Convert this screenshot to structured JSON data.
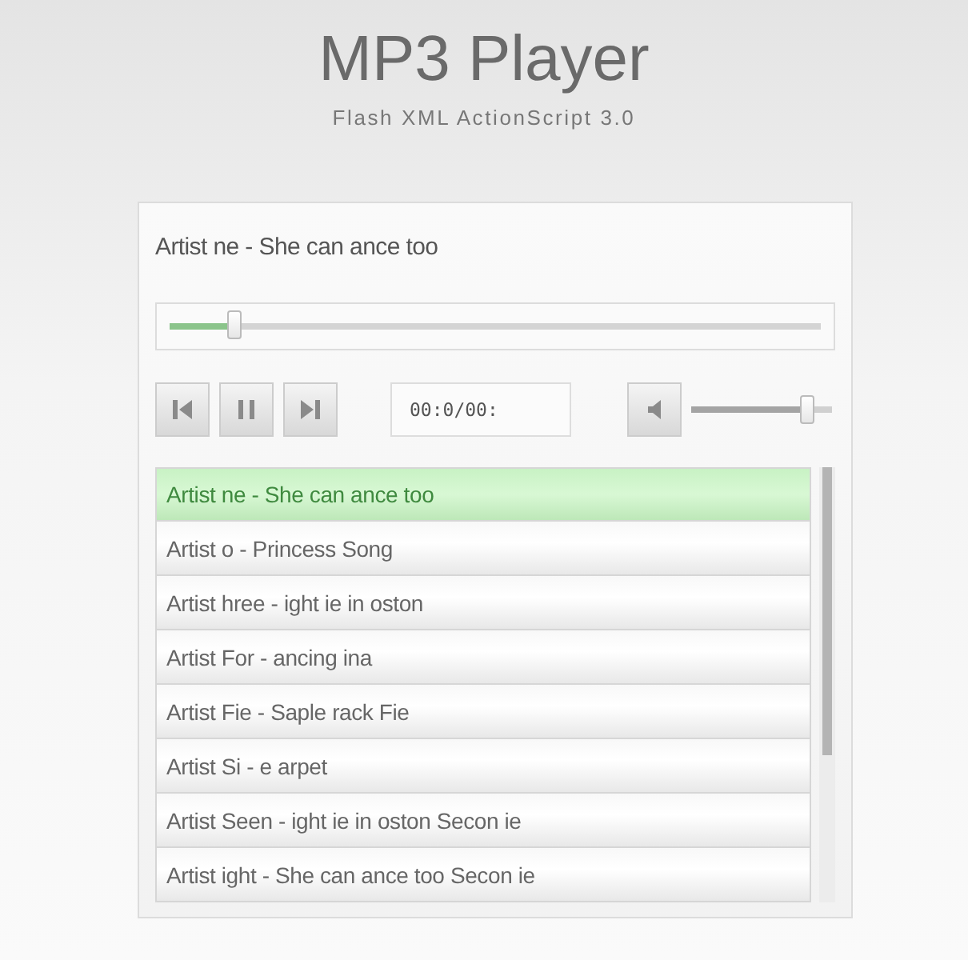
{
  "header": {
    "title": "MP3 Player",
    "subtitle": "Flash XML ActionScript 3.0"
  },
  "player": {
    "now_playing": "Artist ne - She can ance too",
    "progress": {
      "level": 0.1
    },
    "buttons": [
      {
        "kind": "previous"
      },
      {
        "kind": "pause"
      },
      {
        "kind": "next"
      }
    ],
    "time": "00:0/00:",
    "volume": {
      "muted": false,
      "level": 0.83
    },
    "playlist": [
      {
        "label": "Artist ne - She can ance too",
        "selected": true
      },
      {
        "label": "Artist o - Princess Song",
        "selected": false
      },
      {
        "label": "Artist hree - ight ie in oston",
        "selected": false
      },
      {
        "label": "Artist For - ancing ina",
        "selected": false
      },
      {
        "label": "Artist Fie - Saple rack Fie",
        "selected": false
      },
      {
        "label": "Artist Si - e arpet",
        "selected": false
      },
      {
        "label": "Artist Seen - ight ie in oston Secon ie",
        "selected": false
      },
      {
        "label": "Artist ight - She can ance too Secon ie",
        "selected": false
      }
    ]
  }
}
